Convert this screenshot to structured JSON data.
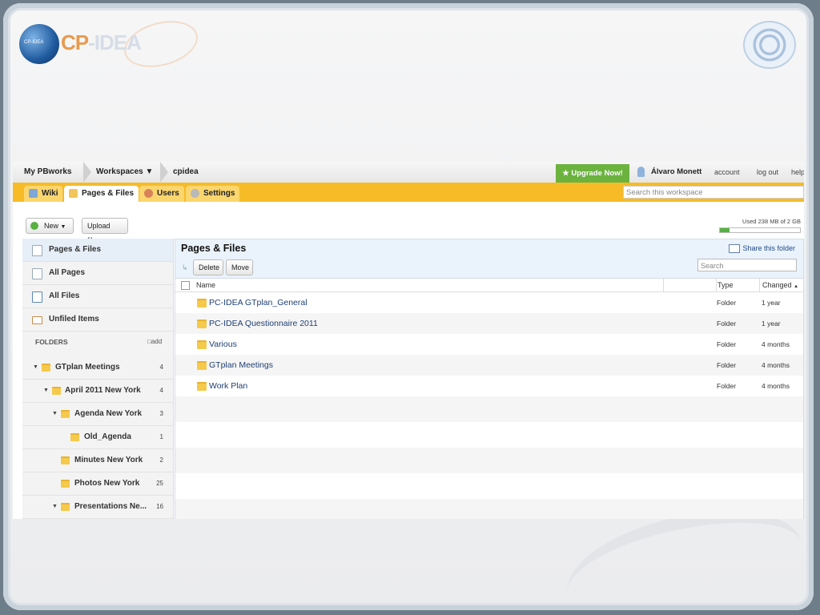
{
  "brand": {
    "logo_small": "CP-IDEA",
    "logo_cp": "CP",
    "logo_idea": "-IDEA"
  },
  "topbar": {
    "breadcrumbs": [
      "My PBworks",
      "Workspaces",
      "cpidea"
    ],
    "upgrade_label": "Upgrade Now!",
    "user_name": "Álvaro Monett",
    "links": [
      "account",
      "log out",
      "help"
    ]
  },
  "tabs": [
    {
      "label": "Wiki"
    },
    {
      "label": "Pages & Files"
    },
    {
      "label": "Users"
    },
    {
      "label": "Settings"
    }
  ],
  "workspace_search": {
    "placeholder": "Search this workspace"
  },
  "toolbar": {
    "new_label": "New",
    "upload_label": "Upload files"
  },
  "usage": {
    "text": "Used 238 MB of 2 GB",
    "fraction": 0.12
  },
  "sidebar": {
    "items": [
      {
        "label": "Pages & Files",
        "selected": true
      },
      {
        "label": "All Pages"
      },
      {
        "label": "All Files"
      },
      {
        "label": "Unfiled Items"
      }
    ],
    "folders_heading": "FOLDERS",
    "add_label": "add",
    "folders": [
      {
        "label": "GTplan Meetings",
        "count": "4"
      },
      {
        "label": "April 2011 New York",
        "count": "4"
      },
      {
        "label": "Agenda New York",
        "count": "3"
      },
      {
        "label": "Old_Agenda",
        "count": "1"
      },
      {
        "label": "Minutes New York",
        "count": "2"
      },
      {
        "label": "Photos New York",
        "count": "25"
      },
      {
        "label": "Presentations Ne...",
        "count": "16"
      }
    ]
  },
  "main": {
    "title": "Pages & Files",
    "share_label": "Share this folder",
    "delete_label": "Delete",
    "move_label": "Move",
    "search_placeholder": "Search",
    "columns": {
      "name": "Name",
      "type": "Type",
      "changed": "Changed"
    },
    "rows": [
      {
        "name": "PC-IDEA GTplan_General",
        "type": "Folder",
        "changed": "1 year"
      },
      {
        "name": "PC-IDEA Questionnaire 2011",
        "type": "Folder",
        "changed": "1 year"
      },
      {
        "name": "Various",
        "type": "Folder",
        "changed": "4 months"
      },
      {
        "name": "GTplan Meetings",
        "type": "Folder",
        "changed": "4 months"
      },
      {
        "name": "Work Plan",
        "type": "Folder",
        "changed": "4 months"
      }
    ]
  }
}
